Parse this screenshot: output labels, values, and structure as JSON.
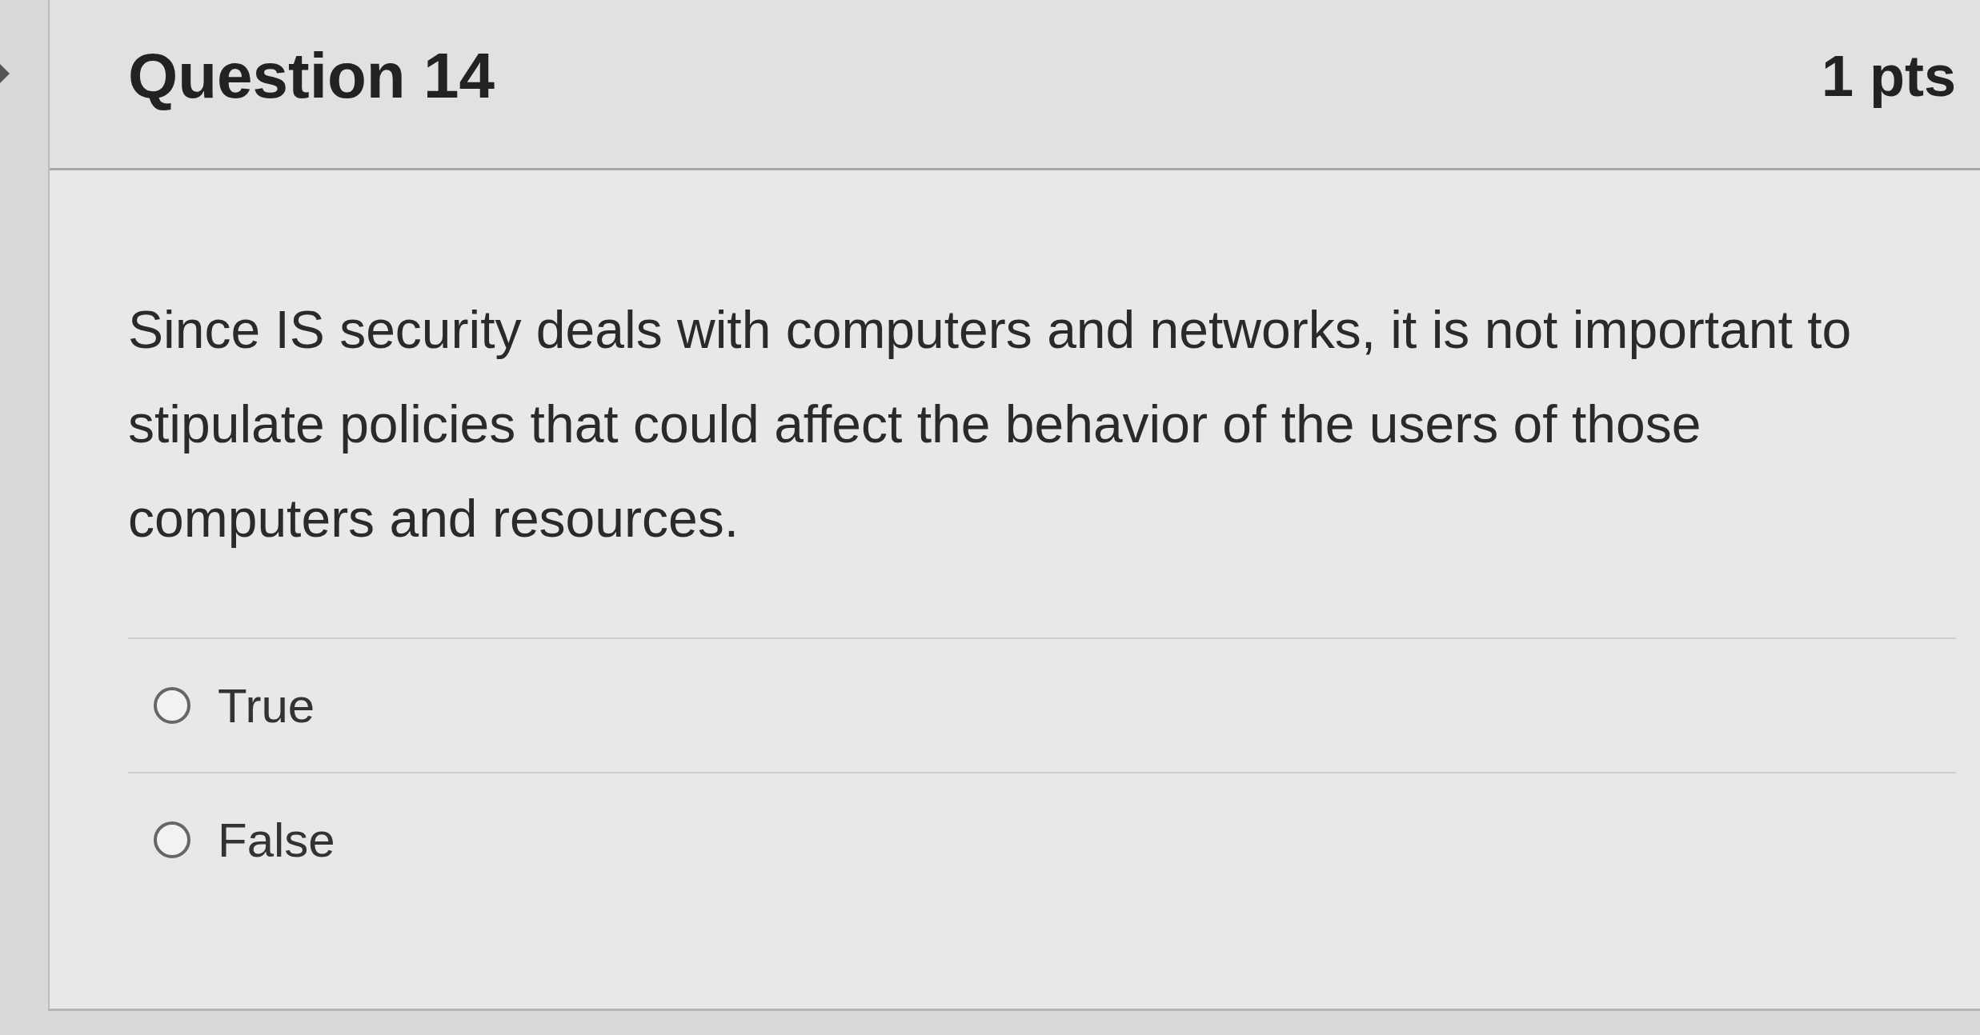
{
  "question": {
    "title": "Question 14",
    "points": "1 pts",
    "text": "Since IS security deals with computers and networks, it is not important to stipulate policies that could affect the behavior of the users of those computers and resources."
  },
  "answers": [
    {
      "label": "True",
      "selected": false
    },
    {
      "label": "False",
      "selected": false
    }
  ]
}
